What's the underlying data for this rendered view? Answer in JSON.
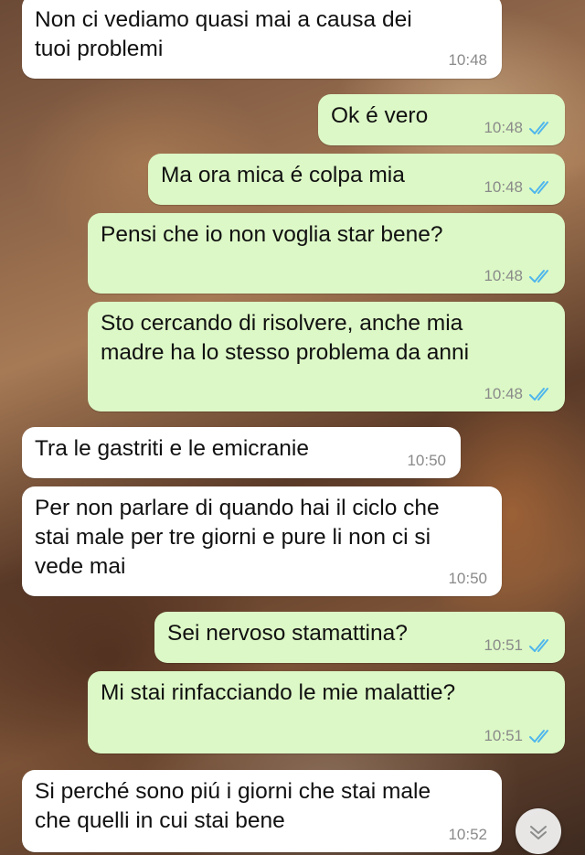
{
  "messages": [
    {
      "dir": "in",
      "text": "Non ci vediamo quasi mai a causa dei\ntuoi problemi",
      "time": "10:48"
    },
    {
      "dir": "out",
      "text": "Ok é vero",
      "time": "10:48",
      "status": "read"
    },
    {
      "dir": "out",
      "text": "Ma ora mica é colpa mia",
      "time": "10:48",
      "status": "read"
    },
    {
      "dir": "out",
      "text": "Pensi che io non voglia star bene?",
      "time": "10:48",
      "status": "read"
    },
    {
      "dir": "out",
      "text": "Sto cercando di risolvere, anche mia\nmadre ha lo stesso problema da anni",
      "time": "10:48",
      "status": "read"
    },
    {
      "dir": "in",
      "text": "Tra le gastriti e le emicranie",
      "time": "10:50"
    },
    {
      "dir": "in",
      "text": "Per non parlare di quando hai il ciclo che\nstai male per tre giorni e pure li non ci si\nvede mai",
      "time": "10:50"
    },
    {
      "dir": "out",
      "text": "Sei nervoso stamattina?",
      "time": "10:51",
      "status": "read"
    },
    {
      "dir": "out",
      "text": "Mi stai rinfacciando le mie malattie?",
      "time": "10:51",
      "status": "read"
    },
    {
      "dir": "in",
      "text": "Si perché sono piú i giorni che stai male\nche quelli in cui stai bene",
      "time": "10:52"
    }
  ],
  "colors": {
    "incoming": "#ffffff",
    "outgoing": "#dcf8c6",
    "read_ticks": "#4fb6ec",
    "time": "#8a8a8a"
  },
  "icons": {
    "read_status": "double-check-icon",
    "scroll_down": "chevron-down-icon"
  }
}
